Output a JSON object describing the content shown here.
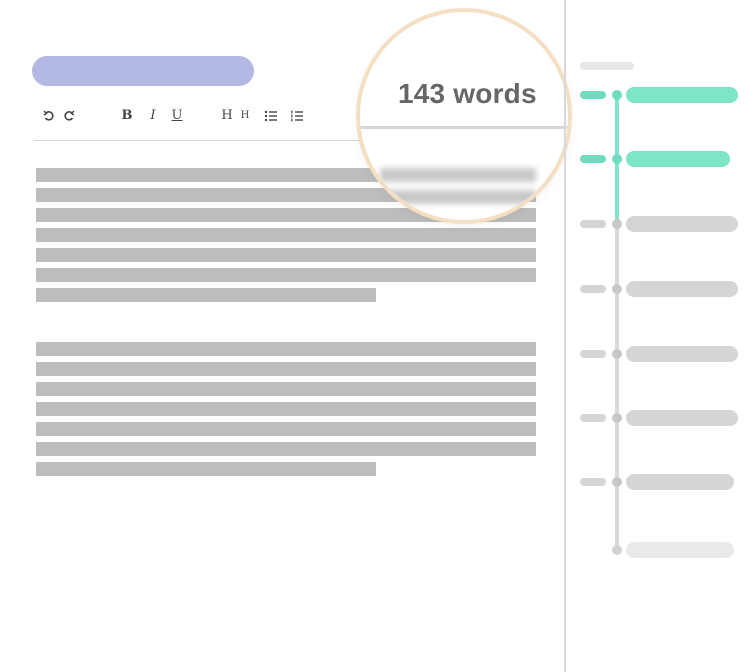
{
  "editor": {
    "toolbar": {
      "undo_icon": "undo-icon",
      "redo_icon": "redo-icon",
      "bold": "B",
      "italic": "I",
      "underline": "U",
      "heading1": "H",
      "heading2": "H",
      "bullet_list_icon": "bullet-list-icon",
      "numbered_list_icon": "numbered-list-icon"
    }
  },
  "magnifier": {
    "word_count": "143 words"
  },
  "colors": {
    "title_pill": "#b4b9e3",
    "active_timeline": "#7ee5c9",
    "inactive_timeline": "#d5d5d5",
    "magnifier_ring": "#f3e0c3"
  }
}
